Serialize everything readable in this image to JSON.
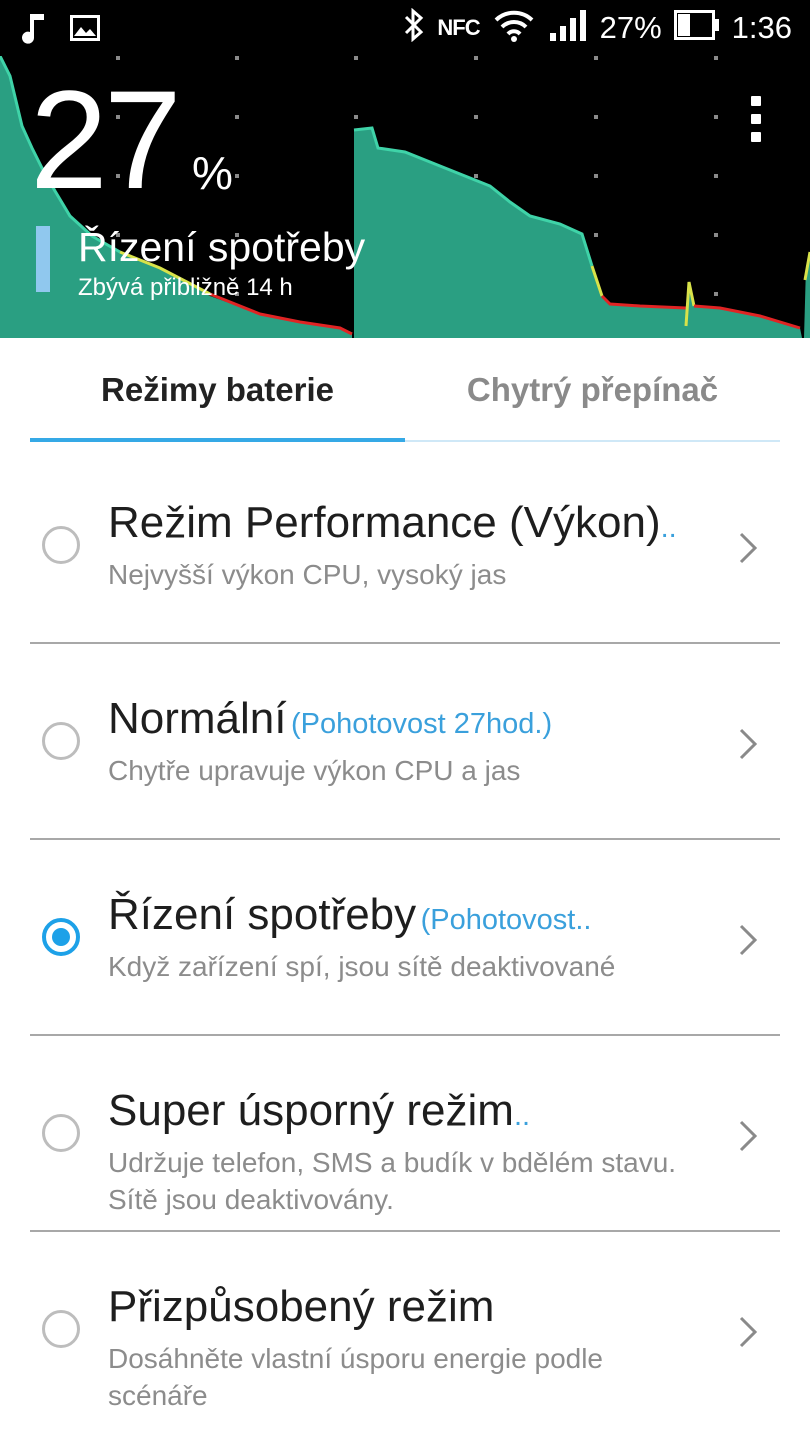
{
  "status_bar": {
    "battery_percent": "27%",
    "time": "1:36",
    "nfc_label": "NFC",
    "icons": [
      "music-note-icon",
      "image-icon",
      "bluetooth-icon",
      "nfc-icon",
      "wifi-icon",
      "signal-icon",
      "battery-icon"
    ]
  },
  "header": {
    "percent_value": "27",
    "percent_sign": "%",
    "current_mode": "Řízení spotřeby",
    "remaining": "Zbývá přibližně 14 h",
    "graph_colors": {
      "fill": "#2a9f82",
      "line_high": "#3fd3a8",
      "line_mid": "#d8e24a",
      "line_low": "#e02424",
      "grid": "#8a8a8a"
    }
  },
  "tabs": [
    {
      "label": "Režimy baterie",
      "active": true
    },
    {
      "label": "Chytrý přepínač",
      "active": false
    }
  ],
  "modes": [
    {
      "title": "Režim Performance (Výkon)",
      "standby": "..",
      "description": "Nejvyšší výkon CPU, vysoký jas",
      "selected": false
    },
    {
      "title": "Normální",
      "standby": "(Pohotovost 27hod.)",
      "description": "Chytře upravuje výkon CPU a jas",
      "selected": false
    },
    {
      "title": "Řízení spotřeby",
      "standby": "(Pohotovost..",
      "description": "Když zařízení spí, jsou sítě deaktivované",
      "selected": true
    },
    {
      "title": "Super úsporný režim",
      "standby": "..",
      "description": "Udržuje telefon, SMS a budík v bdělém stavu. Sítě jsou deaktivovány.",
      "selected": false
    },
    {
      "title": "Přizpůsobený režim",
      "standby": "",
      "description": "Dosáhněte vlastní úsporu energie podle scénáře",
      "selected": false
    }
  ],
  "accent_color": "#1da1e8"
}
